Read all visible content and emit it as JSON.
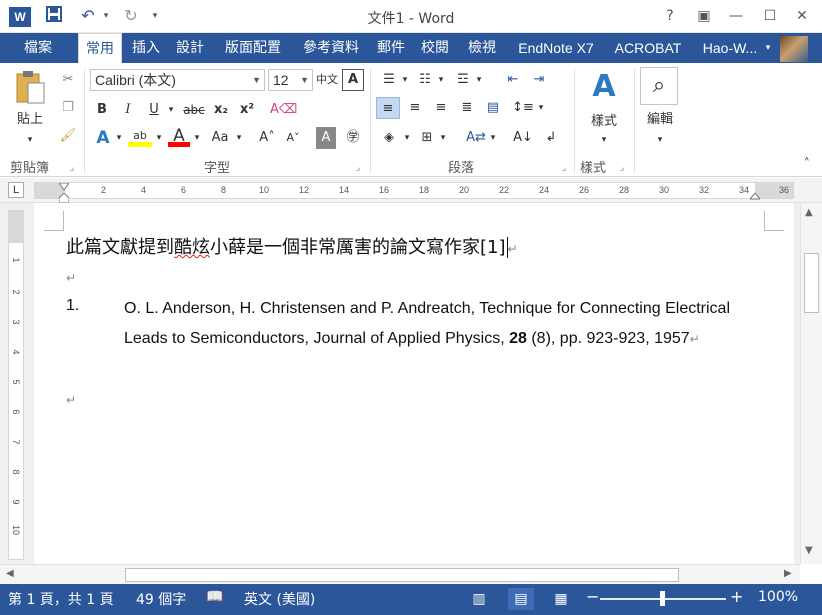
{
  "app": {
    "title": "文件1 - Word",
    "logo_letter": "W"
  },
  "quick_access": {
    "save_icon": "save-icon",
    "undo_icon": "undo-icon",
    "redo_icon": "redo-icon"
  },
  "window_controls": {
    "help": "?",
    "ribbon_display": "▣",
    "minimize": "—",
    "maximize": "☐",
    "close": "✕"
  },
  "tabs": {
    "file": "檔案",
    "items": [
      "常用",
      "插入",
      "設計",
      "版面配置",
      "參考資料",
      "郵件",
      "校閱",
      "檢視",
      "EndNote X7",
      "ACROBAT"
    ],
    "user": "Hao-W..."
  },
  "ribbon": {
    "clipboard": {
      "paste": "貼上",
      "label": "剪貼簿"
    },
    "font": {
      "name": "Calibri (本文)",
      "size": "12",
      "label": "字型"
    },
    "paragraph": {
      "label": "段落"
    },
    "styles": {
      "button": "樣式",
      "label": "樣式"
    },
    "editing": {
      "button": "編輯"
    }
  },
  "ruler": {
    "corner": "L",
    "ticks": [
      "2",
      "2",
      "4",
      "6",
      "8",
      "10",
      "12",
      "14",
      "16",
      "18",
      "20",
      "22",
      "24",
      "26",
      "28",
      "30",
      "32",
      "34",
      "36"
    ],
    "vticks": [
      "1",
      "1",
      "2",
      "3",
      "4",
      "5",
      "6",
      "7",
      "8",
      "9",
      "10",
      "11"
    ]
  },
  "document": {
    "line1_part1": "此篇文獻提到",
    "line1_squiggle": "酷炫",
    "line1_part2": "小薛是一個非常厲害的論文寫作家[1]",
    "pilcrow": "↵",
    "ref_number": "1.",
    "ref_text_before_bold": "O. L. Anderson, H. Christensen and P. Andreatch, Technique for Connecting Electrical Leads to Semiconductors, Journal of Applied Physics, ",
    "ref_bold": "28",
    "ref_text_after_bold": " (8), pp. 923-923, 1957"
  },
  "status": {
    "page": "第 1 頁，共 1 頁",
    "words": "49 個字",
    "language": "英文 (美國)",
    "zoom": "100%",
    "zoom_minus": "−",
    "zoom_plus": "+"
  },
  "colors": {
    "word_blue": "#2b579a",
    "highlight_yellow": "#ffff00",
    "font_red": "#ff0000"
  }
}
